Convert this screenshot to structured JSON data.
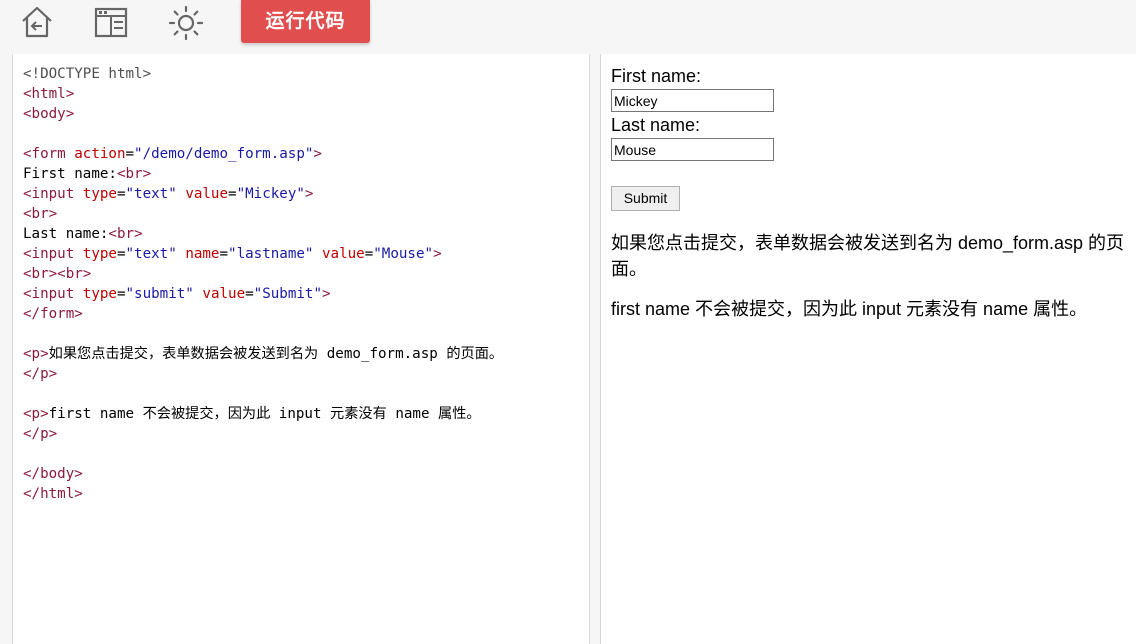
{
  "toolbar": {
    "icons": [
      "home-icon",
      "window-layout-icon",
      "brightness-icon"
    ],
    "run_button_label": "运行代码",
    "run_button_color": "#e04e4e"
  },
  "editor": {
    "lines": [
      [
        {
          "t": "<!DOCTYPE html>",
          "c": "doct"
        }
      ],
      [
        {
          "t": "<html>",
          "c": "tag"
        }
      ],
      [
        {
          "t": "<body>",
          "c": "tag"
        }
      ],
      [],
      [
        {
          "t": "<form ",
          "c": "tag"
        },
        {
          "t": "action",
          "c": "attr"
        },
        {
          "t": "=",
          "c": ""
        },
        {
          "t": "\"/demo/demo_form.asp\"",
          "c": "val"
        },
        {
          "t": ">",
          "c": "tag"
        }
      ],
      [
        {
          "t": "First name:",
          "c": ""
        },
        {
          "t": "<br>",
          "c": "tag"
        }
      ],
      [
        {
          "t": "<input ",
          "c": "tag"
        },
        {
          "t": "type",
          "c": "attr"
        },
        {
          "t": "=",
          "c": ""
        },
        {
          "t": "\"text\"",
          "c": "val"
        },
        {
          "t": " ",
          "c": ""
        },
        {
          "t": "value",
          "c": "attr"
        },
        {
          "t": "=",
          "c": ""
        },
        {
          "t": "\"Mickey\"",
          "c": "val"
        },
        {
          "t": ">",
          "c": "tag"
        }
      ],
      [
        {
          "t": "<br>",
          "c": "tag"
        }
      ],
      [
        {
          "t": "Last name:",
          "c": ""
        },
        {
          "t": "<br>",
          "c": "tag"
        }
      ],
      [
        {
          "t": "<input ",
          "c": "tag"
        },
        {
          "t": "type",
          "c": "attr"
        },
        {
          "t": "=",
          "c": ""
        },
        {
          "t": "\"text\"",
          "c": "val"
        },
        {
          "t": " ",
          "c": ""
        },
        {
          "t": "name",
          "c": "attr"
        },
        {
          "t": "=",
          "c": ""
        },
        {
          "t": "\"lastname\"",
          "c": "val"
        },
        {
          "t": " ",
          "c": ""
        },
        {
          "t": "value",
          "c": "attr"
        },
        {
          "t": "=",
          "c": ""
        },
        {
          "t": "\"Mouse\"",
          "c": "val"
        },
        {
          "t": ">",
          "c": "tag"
        }
      ],
      [
        {
          "t": "<br><br>",
          "c": "tag"
        }
      ],
      [
        {
          "t": "<input ",
          "c": "tag"
        },
        {
          "t": "type",
          "c": "attr"
        },
        {
          "t": "=",
          "c": ""
        },
        {
          "t": "\"submit\"",
          "c": "val"
        },
        {
          "t": " ",
          "c": ""
        },
        {
          "t": "value",
          "c": "attr"
        },
        {
          "t": "=",
          "c": ""
        },
        {
          "t": "\"Submit\"",
          "c": "val"
        },
        {
          "t": ">",
          "c": "tag"
        }
      ],
      [
        {
          "t": "</form>",
          "c": "tag"
        }
      ],
      [],
      [
        {
          "t": "<p>",
          "c": "tag"
        },
        {
          "t": "如果您点击提交，表单数据会被发送到名为 demo_form.asp 的页面。",
          "c": ""
        }
      ],
      [
        {
          "t": "</p>",
          "c": "tag"
        }
      ],
      [],
      [
        {
          "t": "<p>",
          "c": "tag"
        },
        {
          "t": "first name 不会被提交，因为此 input 元素没有 name 属性。",
          "c": ""
        }
      ],
      [
        {
          "t": "</p>",
          "c": "tag"
        }
      ],
      [],
      [
        {
          "t": "</body>",
          "c": "tag"
        }
      ],
      [
        {
          "t": "</html>",
          "c": "tag"
        }
      ]
    ]
  },
  "preview": {
    "first_name_label": "First name:",
    "first_name_value": "Mickey",
    "last_name_label": "Last name:",
    "last_name_value": "Mouse",
    "submit_label": "Submit",
    "paragraph1": "如果您点击提交，表单数据会被发送到名为 demo_form.asp 的页面。",
    "paragraph2": "first name 不会被提交，因为此 input 元素没有 name 属性。"
  }
}
